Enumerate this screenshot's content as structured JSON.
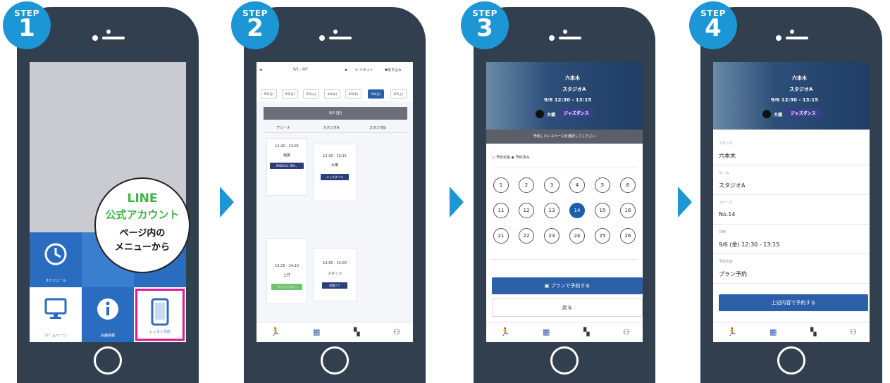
{
  "steps": [
    {
      "label": "STEP",
      "number": "1"
    },
    {
      "label": "STEP",
      "number": "2"
    },
    {
      "label": "STEP",
      "number": "3"
    },
    {
      "label": "STEP",
      "number": "4"
    }
  ],
  "step1": {
    "bubble": {
      "line1": "LINE",
      "line2": "公式アカウント",
      "line3": "ページ内の",
      "line4": "メニューから"
    },
    "tiles": [
      "スケジュール",
      "ホームページ",
      "店舗情報",
      "レッスン予約"
    ],
    "highlight_color": "#e0198c"
  },
  "step2": {
    "week": "9/1 - 9/7",
    "reset": "リセット",
    "filter": "絞り込み",
    "days": [
      "9/1(日)",
      "9/2(月)",
      "9/3(火)",
      "9/4(水)",
      "9/5(木)",
      "9/6(金)",
      "9/7(土)"
    ],
    "date_header": "9/6 (金)",
    "columns": [
      "アリーナ",
      "スタジオA",
      "スタジオB"
    ],
    "slots": [
      {
        "time": "12:20 - 13:05",
        "instructor": "稲葉",
        "tag": "RADICAL FEN..."
      },
      {
        "time": "12:30 - 13:15",
        "instructor": "大橋",
        "tag": "ジャズダンス"
      },
      {
        "time": "13:25 - 14:10",
        "instructor": "土井",
        "tag": "ベーシックス..."
      },
      {
        "time": "13:30 - 14:00",
        "instructor": "スタッフ",
        "tag": "骨盤ケア"
      }
    ]
  },
  "hero": {
    "location": "六本木",
    "studio": "スタジオA",
    "date_time": "9/6  12:30 - 13:15",
    "instructor": "大橋",
    "program": "ジャズダンス"
  },
  "step3": {
    "instruction": "予約したいスペースを選択してください",
    "legend_available": "予約可能",
    "legend_reserved": "予約済み",
    "numbers": [
      "1",
      "2",
      "3",
      "4",
      "5",
      "6",
      "11",
      "12",
      "13",
      "14",
      "15",
      "16",
      "21",
      "22",
      "23",
      "24",
      "25",
      "26"
    ],
    "selected": "14",
    "primary_button": "プランで予約する",
    "back_button": "戻る"
  },
  "step4": {
    "fields": [
      {
        "label": "スタジオ",
        "value": "六本木"
      },
      {
        "label": "ルーム",
        "value": "スタジオA"
      },
      {
        "label": "スペース",
        "value": "No.14"
      },
      {
        "label": "日時",
        "value": "9/6 (金) 12:30 - 13:15"
      },
      {
        "label": "予約内容",
        "value": "プラン予約"
      }
    ],
    "confirm_button": "上記内容で予約する"
  },
  "nav": {
    "icons": [
      "runner-icon",
      "calendar-icon",
      "qr-icon",
      "user-icon"
    ]
  },
  "colors": {
    "brand_blue": "#1c96d4",
    "phone_body": "#313f4f",
    "button_blue": "#2b5fa8",
    "tag_navy": "#2d3d7a",
    "tag_green": "#6fc56f"
  }
}
